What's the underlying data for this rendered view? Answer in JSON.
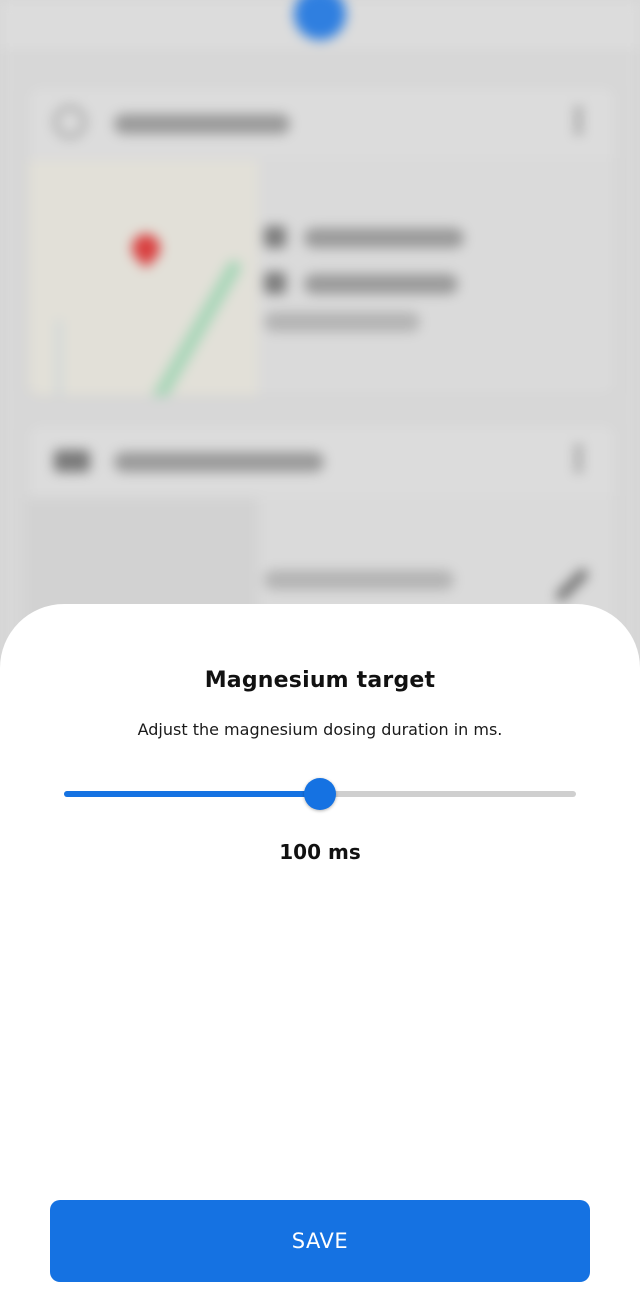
{
  "sheet": {
    "title": "Magnesium target",
    "description": "Adjust the magnesium dosing duration in ms.",
    "slider": {
      "value_fraction": 0.5,
      "value_label": "100 ms"
    },
    "save_label": "SAVE"
  },
  "colors": {
    "accent": "#1572e2",
    "track": "#cfcfcf",
    "sheet_background": "#ffffff",
    "scrim": "#d6d6d6"
  },
  "icons": {
    "water_quality_card": "water-drop-icon",
    "dosing_device_card": "device-icon",
    "card_menu": "more-vertical-icon",
    "map_marker": "map-pin-icon",
    "edit": "pencil-icon"
  }
}
